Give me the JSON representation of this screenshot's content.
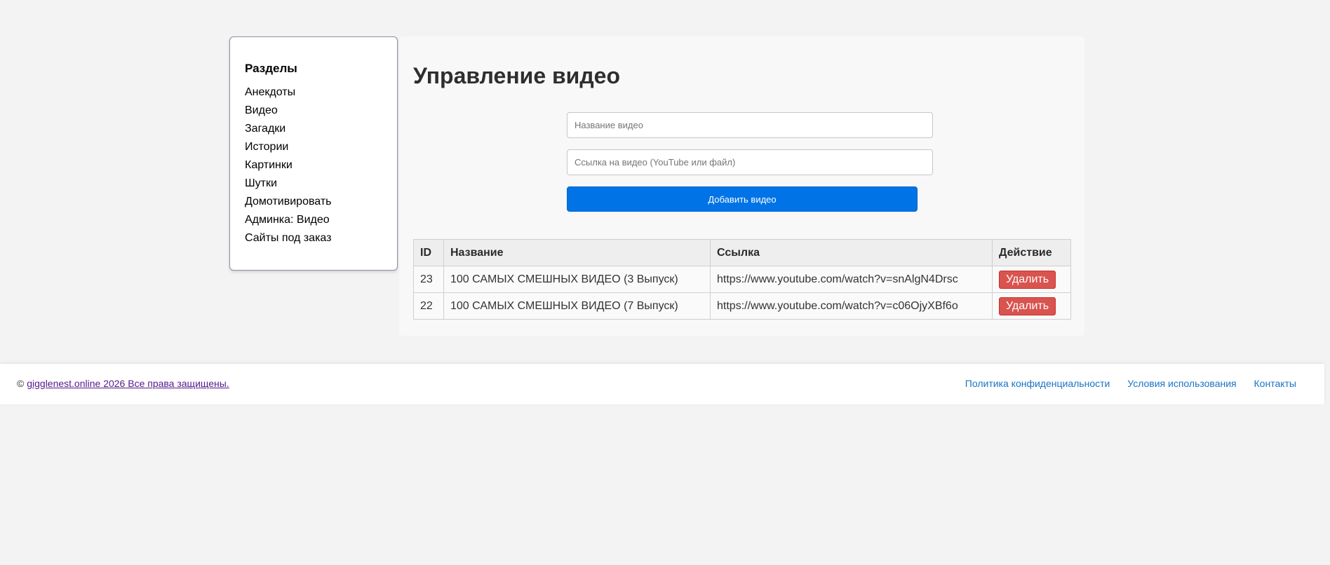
{
  "sidebar": {
    "title": "Разделы",
    "items": [
      {
        "label": "Анекдоты"
      },
      {
        "label": "Видео"
      },
      {
        "label": "Загадки"
      },
      {
        "label": "Истории"
      },
      {
        "label": "Картинки"
      },
      {
        "label": "Шутки"
      },
      {
        "label": "Домотивировать"
      },
      {
        "label": "Админка: Видео"
      },
      {
        "label": "Сайты под заказ"
      }
    ]
  },
  "main": {
    "title": "Управление видео",
    "form": {
      "name_placeholder": "Название видео",
      "link_placeholder": "Ссылка на видео (YouTube или файл)",
      "submit_label": "Добавить видео"
    },
    "table": {
      "headers": [
        "ID",
        "Название",
        "Ссылка",
        "Действие"
      ],
      "rows": [
        {
          "id": "23",
          "name": "100 САМЫХ СМЕШНЫХ ВИДЕО (3 Выпуск)",
          "link": "https://www.youtube.com/watch?v=snAlgN4Drsc",
          "action": "Удалить"
        },
        {
          "id": "22",
          "name": "100 САМЫХ СМЕШНЫХ ВИДЕО (7 Выпуск)",
          "link": "https://www.youtube.com/watch?v=c06OjyXBf6o",
          "action": "Удалить"
        }
      ]
    }
  },
  "footer": {
    "copyright_symbol": "©",
    "copyright_text": "gigglenest.online 2026 Все права защищены.",
    "links": [
      {
        "label": "Политика конфиденциальности"
      },
      {
        "label": "Условия использования"
      },
      {
        "label": "Контакты"
      }
    ]
  },
  "colors": {
    "primary_button": "#0073e6",
    "danger_button": "#d9534f",
    "footer_link": "#1a73c7",
    "visited_link": "#551a8b"
  }
}
